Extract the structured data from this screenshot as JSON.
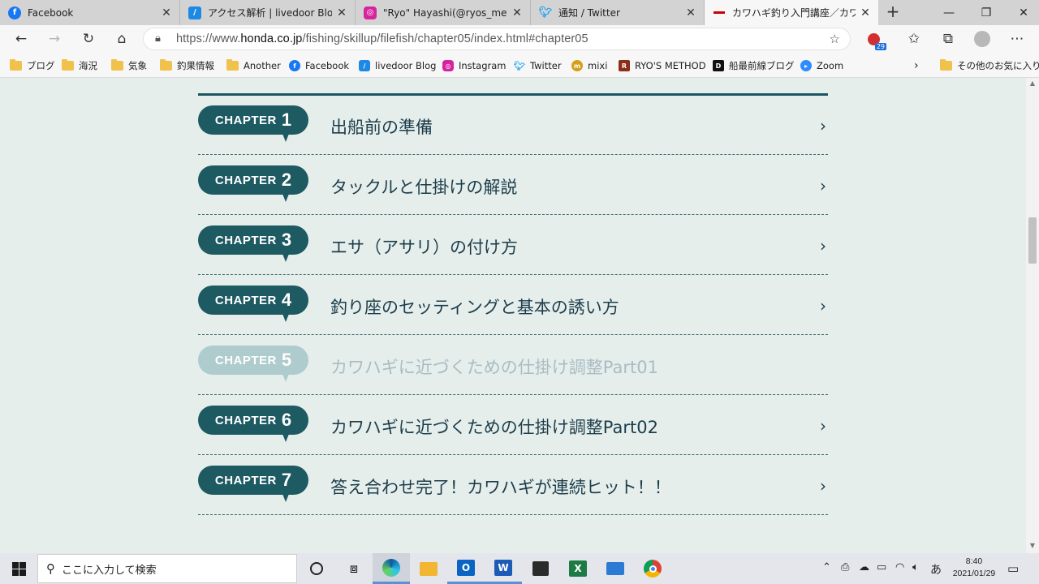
{
  "browser": {
    "tabs": [
      {
        "title": "Facebook",
        "icon": "facebook-icon",
        "color": "#1877f2"
      },
      {
        "title": "アクセス解析 | livedoor Blog",
        "icon": "livedoor-icon",
        "color": "#1e88e5"
      },
      {
        "title": "\"Ryo\" Hayashi(@ryos_method)",
        "icon": "instagram-icon",
        "color": "#d6249f"
      },
      {
        "title": "通知 / Twitter",
        "icon": "twitter-icon",
        "color": "#1da1f2"
      },
      {
        "title": "カワハギ釣り入門講座／カワハギに",
        "icon": "honda-icon",
        "color": "#cc0000",
        "active": true
      }
    ],
    "new_tab_label": "+",
    "close_glyph": "✕",
    "url_prefix": "https://www.",
    "url_domain": "honda.co.jp",
    "url_path": "/fishing/skillup/filefish/chapter05/index.html#chapter05",
    "extension_badge": "29"
  },
  "favorites": [
    {
      "label": "ブログ",
      "type": "folder"
    },
    {
      "label": "海況",
      "type": "folder"
    },
    {
      "label": "気象",
      "type": "folder"
    },
    {
      "label": "釣果情報",
      "type": "folder"
    },
    {
      "label": "Another",
      "type": "folder"
    },
    {
      "label": "Facebook",
      "type": "site",
      "icon": "facebook-icon",
      "color": "#1877f2"
    },
    {
      "label": "livedoor Blog",
      "type": "site",
      "icon": "livedoor-icon",
      "color": "#1e88e5"
    },
    {
      "label": "Instagram",
      "type": "site",
      "icon": "instagram-icon",
      "color": "#d6249f"
    },
    {
      "label": "Twitter",
      "type": "site",
      "icon": "twitter-icon",
      "color": "#1da1f2"
    },
    {
      "label": "mixi",
      "type": "site",
      "icon": "mixi-icon",
      "color": "#d4a017"
    },
    {
      "label": "RYO'S METHOD",
      "type": "site",
      "icon": "ryos-method-icon",
      "color": "#8b2e1a"
    },
    {
      "label": "船最前線ブログ",
      "type": "site",
      "icon": "daiwa-icon",
      "color": "#111111"
    },
    {
      "label": "Zoom",
      "type": "site",
      "icon": "zoom-icon",
      "color": "#2d8cff"
    }
  ],
  "favorites_other": "その他のお気に入り",
  "chapters": [
    {
      "word": "CHAPTER",
      "num": "1",
      "title": "出船前の準備",
      "current": false
    },
    {
      "word": "CHAPTER",
      "num": "2",
      "title": "タックルと仕掛けの解説",
      "current": false
    },
    {
      "word": "CHAPTER",
      "num": "3",
      "title": "エサ（アサリ）の付け方",
      "current": false
    },
    {
      "word": "CHAPTER",
      "num": "4",
      "title": "釣り座のセッティングと基本の誘い方",
      "current": false
    },
    {
      "word": "CHAPTER",
      "num": "5",
      "title": "カワハギに近づくための仕掛け調整Part01",
      "current": true
    },
    {
      "word": "CHAPTER",
      "num": "6",
      "title": "カワハギに近づくための仕掛け調整Part02",
      "current": false
    },
    {
      "word": "CHAPTER",
      "num": "7",
      "title": "答え合わせ完了！カワハギが連続ヒット！！",
      "current": false
    }
  ],
  "chapter_arrow": "›",
  "colors": {
    "badge": "#1d5a62",
    "badge_dim": "#aecbce",
    "page_bg": "#e6eeec"
  },
  "taskbar": {
    "search_placeholder": "ここに入力して検索",
    "ime": "あ",
    "time": "8:40",
    "date": "2021/01/29"
  }
}
